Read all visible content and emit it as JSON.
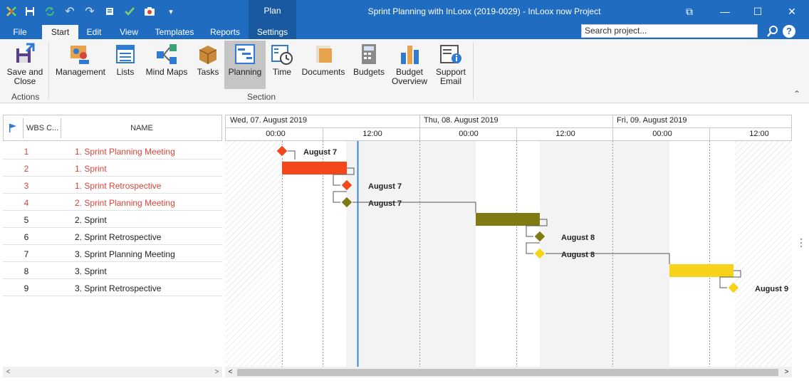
{
  "window": {
    "title": "Sprint Planning with InLoox (2019-0029) - InLoox now Project",
    "restore_glyph": "⧉",
    "minimize_glyph": "—",
    "maximize_glyph": "☐",
    "close_glyph": "✕"
  },
  "qat": {
    "undo_glyph": "↶",
    "redo_glyph": "↷",
    "dropdown_glyph": "▾"
  },
  "ribbon": {
    "context_group": "Plan",
    "tabs": [
      "File",
      "Start",
      "Edit",
      "View",
      "Templates",
      "Reports",
      "Settings"
    ],
    "search_placeholder": "Search project...",
    "help_glyph": "?",
    "collapse_glyph": "⌃",
    "buttons": {
      "save_close": "Save and\nClose",
      "management": "Management",
      "lists": "Lists",
      "mind_maps": "Mind Maps",
      "tasks": "Tasks",
      "planning": "Planning",
      "time": "Time",
      "documents": "Documents",
      "budgets": "Budgets",
      "budget_overview": "Budget\nOverview",
      "support_email": "Support\nEmail"
    },
    "groups": {
      "actions": "Actions",
      "section": "Section"
    }
  },
  "grid": {
    "columns": {
      "wbs": "WBS C...",
      "name": "NAME"
    },
    "rows": [
      {
        "wbs": "1",
        "name": "1. Sprint Planning Meeting",
        "highlight": true
      },
      {
        "wbs": "2",
        "name": "1. Sprint",
        "highlight": true
      },
      {
        "wbs": "3",
        "name": "1. Sprint Retrospective",
        "highlight": true
      },
      {
        "wbs": "4",
        "name": "2. Sprint Planning Meeting",
        "highlight": true
      },
      {
        "wbs": "5",
        "name": "2. Sprint",
        "highlight": false
      },
      {
        "wbs": "6",
        "name": "2. Sprint Retrospective",
        "highlight": false
      },
      {
        "wbs": "7",
        "name": "3. Sprint Planning Meeting",
        "highlight": false
      },
      {
        "wbs": "8",
        "name": "3. Sprint",
        "highlight": false
      },
      {
        "wbs": "9",
        "name": "3. Sprint Retrospective",
        "highlight": false
      }
    ]
  },
  "gantt": {
    "days": [
      "Wed, 07. August 2019",
      "Thu, 08. August 2019",
      "Fri, 09. August 2019"
    ],
    "hours": [
      "00:00",
      "12:00",
      "00:00",
      "12:00",
      "00:00",
      "12:00"
    ],
    "labels": [
      "August 7",
      "August 7",
      "August 7",
      "August 8",
      "August 8",
      "August 9"
    ],
    "colors": {
      "sprint1": "#f5471c",
      "sprint2": "#7f7a12",
      "sprint3": "#f7d21a",
      "today_line": "#3a8ad6"
    }
  },
  "scroll": {
    "left_glyph": "<",
    "right_glyph": ">"
  }
}
